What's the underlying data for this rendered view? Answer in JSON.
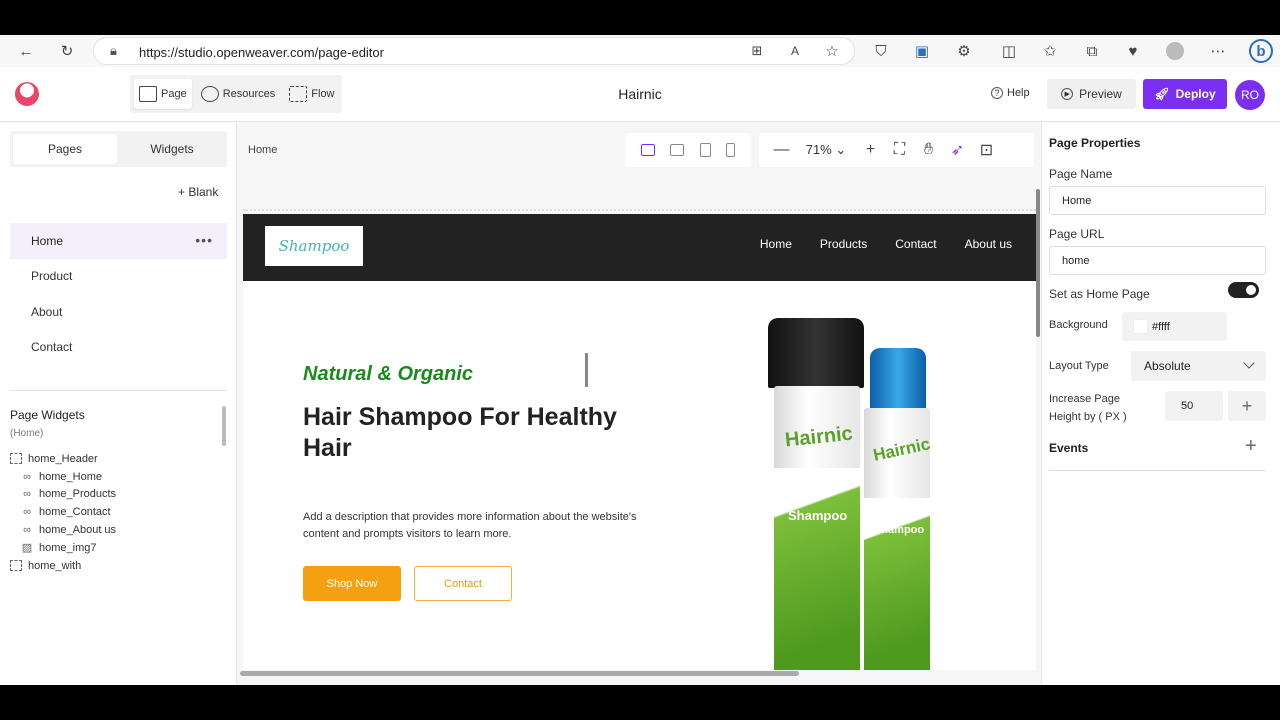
{
  "browser": {
    "url": "https://studio.openweaver.com/page-editor"
  },
  "header": {
    "modes": [
      {
        "label": "Page",
        "active": true
      },
      {
        "label": "Resources",
        "active": false
      },
      {
        "label": "Flow",
        "active": false
      }
    ],
    "title": "Hairnic",
    "help_label": "Help",
    "preview_label": "Preview",
    "deploy_label": "Deploy",
    "avatar_initials": "RO",
    "accent_color": "#7b2ff2"
  },
  "left_panel": {
    "tabs": [
      {
        "label": "Pages",
        "active": true
      },
      {
        "label": "Widgets",
        "active": false
      }
    ],
    "blank_label": "+ Blank",
    "pages": [
      {
        "label": "Home",
        "active": true
      },
      {
        "label": "Product",
        "active": false
      },
      {
        "label": "About",
        "active": false
      },
      {
        "label": "Contact",
        "active": false
      }
    ],
    "widgets_title": "Page Widgets",
    "widgets_subtitle": "(Home)",
    "widgets": [
      {
        "label": "home_Header",
        "icon": "container-icon",
        "child": false
      },
      {
        "label": "home_Home",
        "icon": "link-icon",
        "child": true
      },
      {
        "label": "home_Products",
        "icon": "link-icon",
        "child": true
      },
      {
        "label": "home_Contact",
        "icon": "link-icon",
        "child": true
      },
      {
        "label": "home_About us",
        "icon": "link-icon",
        "child": true
      },
      {
        "label": "home_img7",
        "icon": "image-icon",
        "child": true
      },
      {
        "label": "home_with",
        "icon": "container-icon",
        "child": false
      }
    ]
  },
  "canvas": {
    "breadcrumb": "Home",
    "zoom": "71%",
    "site": {
      "logo_text": "Shampoo",
      "nav": [
        "Home",
        "Products",
        "Contact",
        "About us"
      ],
      "kicker": "Natural & Organic",
      "headline": "Hair Shampoo For Healthy Hair",
      "description": "Add a description that provides more information about the website's content and prompts visitors to learn more.",
      "shop_button": "Shop Now",
      "contact_button": "Contact",
      "product_brand": "Hairnic",
      "product_label": "Shampoo"
    }
  },
  "right_panel": {
    "title": "Page Properties",
    "page_name_label": "Page Name",
    "page_name_value": "Home",
    "page_url_label": "Page URL",
    "page_url_value": "home",
    "home_toggle_label": "Set as Home Page",
    "home_toggle_on": true,
    "background_label": "Background",
    "background_value": "#ffff",
    "layout_label": "Layout Type",
    "layout_value": "Absolute",
    "increase_label_1": "Increase Page",
    "increase_label_2": "Height by ( PX )",
    "increase_value": "50",
    "events_label": "Events"
  }
}
